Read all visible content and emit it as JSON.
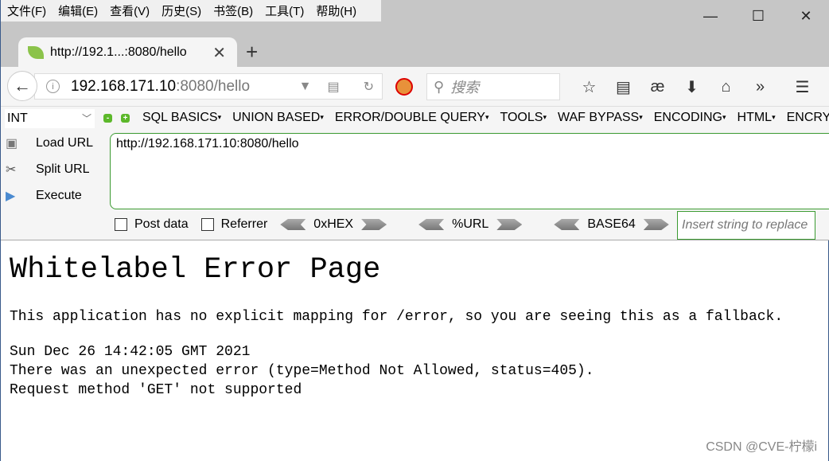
{
  "menu": [
    "文件(F)",
    "编辑(E)",
    "查看(V)",
    "历史(S)",
    "书签(B)",
    "工具(T)",
    "帮助(H)"
  ],
  "tab": {
    "title": "http://192.1...:8080/hello"
  },
  "urlbar": {
    "host": "192.168.171.10",
    "rest": ":8080/hello"
  },
  "search": {
    "placeholder": "搜索"
  },
  "hackbar": {
    "select": "INT",
    "menus": [
      "SQL BASICS",
      "UNION BASED",
      "ERROR/DOUBLE QUERY",
      "TOOLS",
      "WAF BYPASS",
      "ENCODING",
      "HTML",
      "ENCRY"
    ],
    "load": "Load URL",
    "split": "Split URL",
    "execute": "Execute",
    "url": "http://192.168.171.10:8080/hello",
    "post": "Post data",
    "referrer": "Referrer",
    "hex": "0xHEX",
    "urlenc": "%URL",
    "base64": "BASE64",
    "insert_placeholder": "Insert string to replace"
  },
  "page": {
    "title": "Whitelabel Error Page",
    "line1": "This application has no explicit mapping for /error, so you are seeing this as a fallback.",
    "date": "Sun Dec 26 14:42:05 GMT 2021",
    "error": "There was an unexpected error (type=Method Not Allowed, status=405).",
    "method": "Request method 'GET' not supported"
  },
  "watermark": "CSDN @CVE-柠檬i"
}
